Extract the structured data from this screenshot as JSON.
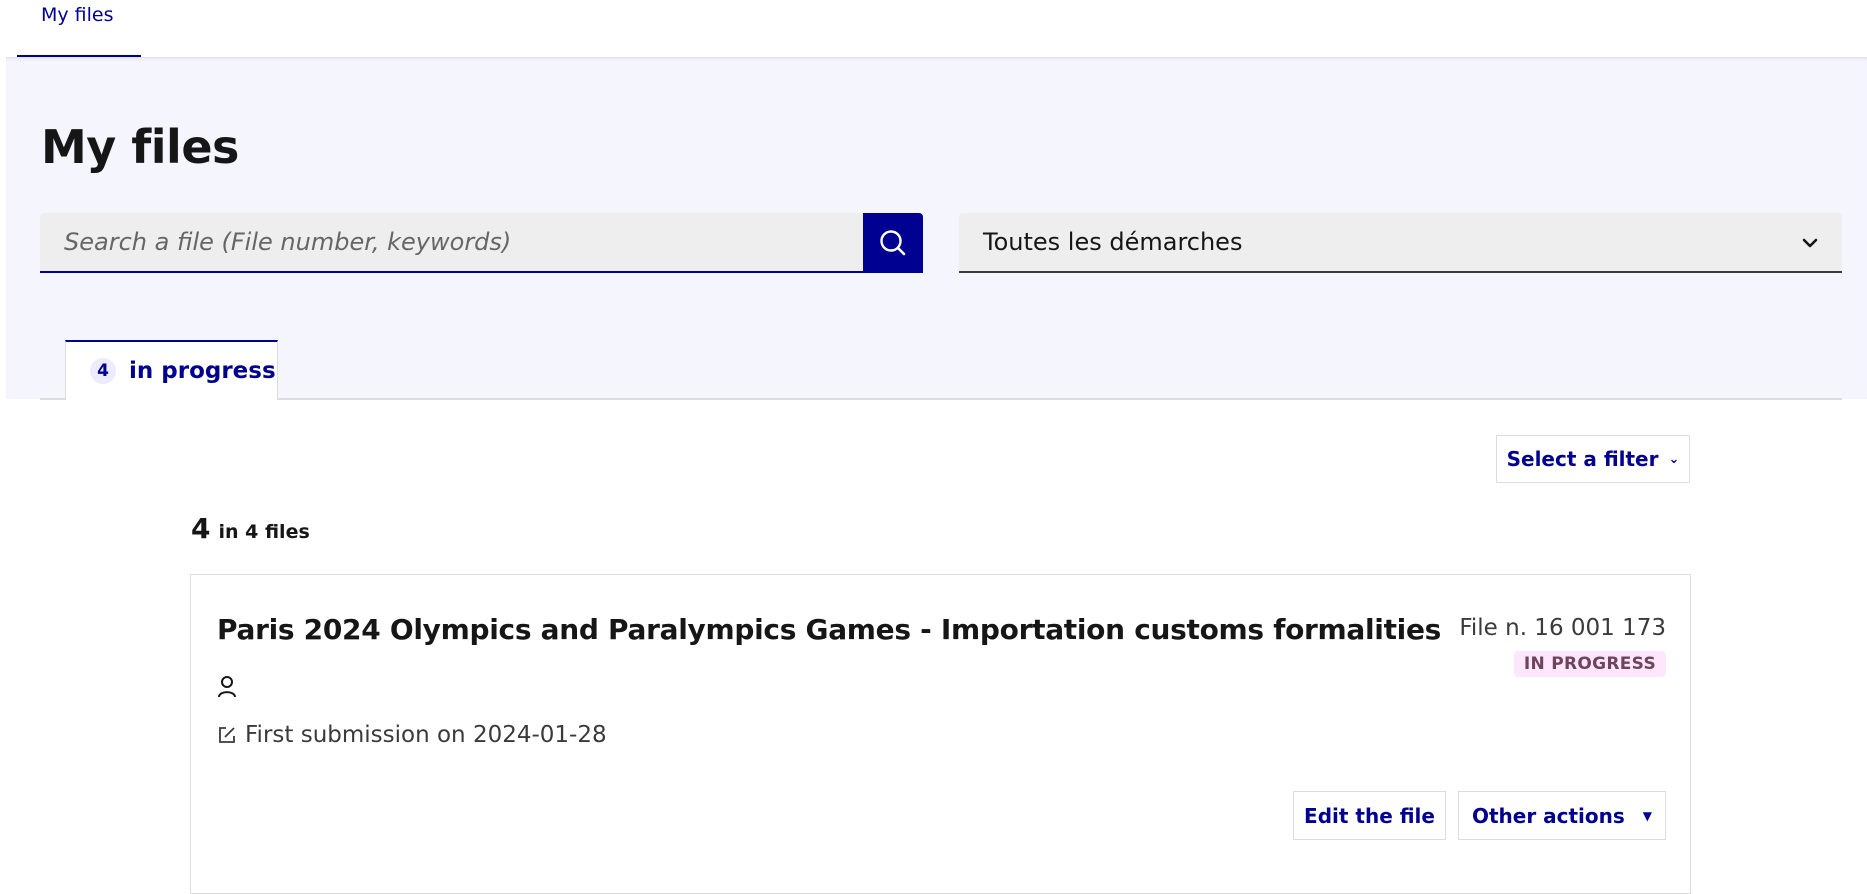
{
  "nav": {
    "tab_label": "My files"
  },
  "header": {
    "title": "My files"
  },
  "search": {
    "placeholder": "Search a file (File number, keywords)",
    "button_icon": "search-icon"
  },
  "procedure_select": {
    "selected": "Toutes les démarches",
    "icon": "chevron-down-icon"
  },
  "tabs": [
    {
      "count": "4",
      "label": "in progress",
      "active": true
    }
  ],
  "filter": {
    "label": "Select a filter",
    "chevron": "⌄"
  },
  "results": {
    "count": "4",
    "summary": "in 4 files"
  },
  "files": [
    {
      "title": "Paris 2024 Olympics and Paralympics Games - Importation customs formalities",
      "file_number": "File n. 16 001 173",
      "status": "IN PROGRESS",
      "submission": "First submission on 2024-01-28",
      "edit_label": "Edit the file",
      "other_actions_label": "Other actions",
      "other_actions_caret": "▼"
    }
  ],
  "colors": {
    "primary": "#000091",
    "hero_bg": "#f5f5fe",
    "input_bg": "#eeeeee",
    "badge_bg": "#fee7fc",
    "badge_text": "#6e445a"
  }
}
